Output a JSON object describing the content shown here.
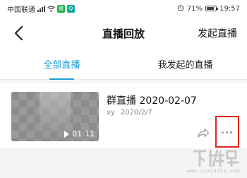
{
  "status_bar": {
    "carrier": "中国联通",
    "network": "4G",
    "battery_percent": "71%",
    "time": "19:57",
    "app_badges": [
      "微",
      "Q"
    ]
  },
  "nav": {
    "title": "直播回放",
    "action": "发起直播",
    "back_icon": "chevron-left-icon"
  },
  "tabs": [
    {
      "label": "全部直播",
      "active": true
    },
    {
      "label": "我发起的直播",
      "active": false
    }
  ],
  "items": [
    {
      "title": "群直播 2020-02-07",
      "author": "xy",
      "date": "2020/2/7",
      "duration": "01:11"
    }
  ],
  "watermark": {
    "brand_text": "下载吧",
    "url": "www.xiazaiba.com"
  },
  "colors": {
    "accent": "#1aa0d8",
    "highlight": "#e2231a"
  }
}
